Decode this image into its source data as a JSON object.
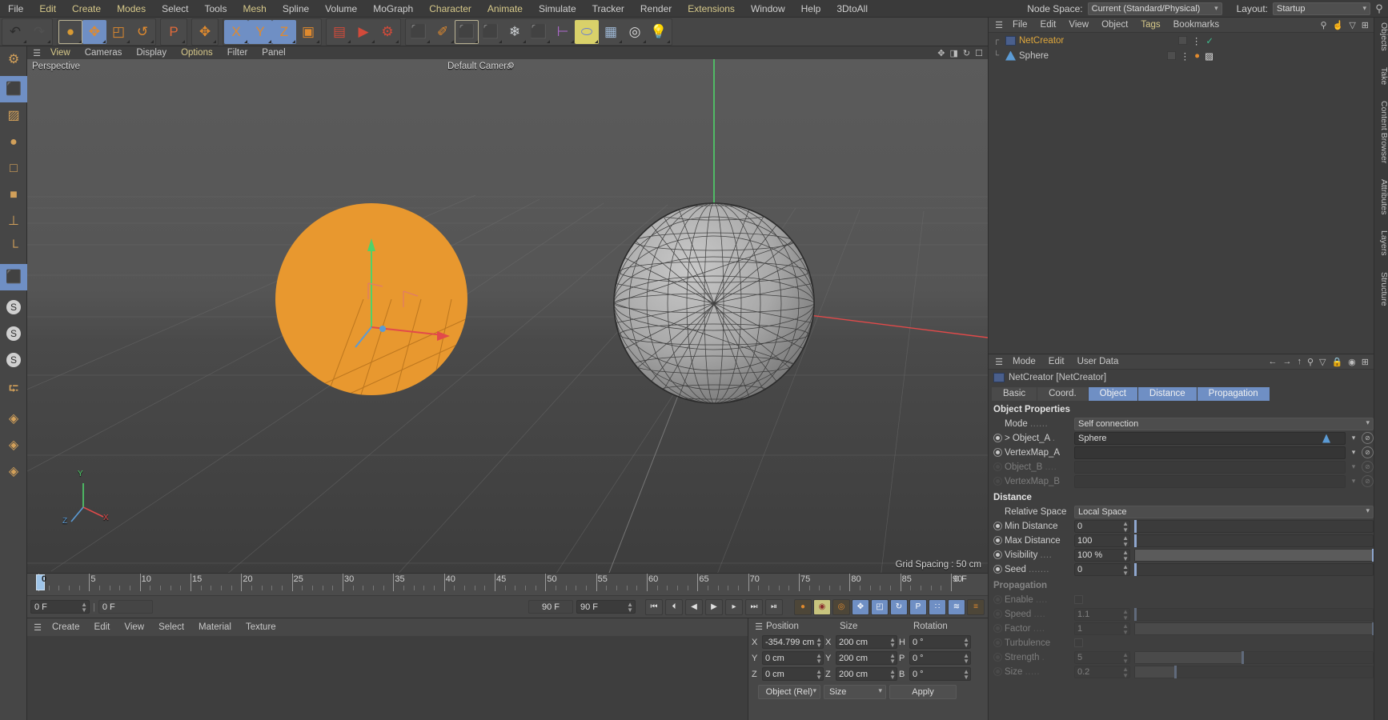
{
  "menubar": {
    "items": [
      {
        "label": "File",
        "hl": false
      },
      {
        "label": "Edit",
        "hl": true
      },
      {
        "label": "Create",
        "hl": true
      },
      {
        "label": "Modes",
        "hl": true
      },
      {
        "label": "Select",
        "hl": false
      },
      {
        "label": "Tools",
        "hl": false
      },
      {
        "label": "Mesh",
        "hl": true
      },
      {
        "label": "Spline",
        "hl": false
      },
      {
        "label": "Volume",
        "hl": false
      },
      {
        "label": "MoGraph",
        "hl": false
      },
      {
        "label": "Character",
        "hl": true
      },
      {
        "label": "Animate",
        "hl": true
      },
      {
        "label": "Simulate",
        "hl": false
      },
      {
        "label": "Tracker",
        "hl": false
      },
      {
        "label": "Render",
        "hl": false
      },
      {
        "label": "Extensions",
        "hl": true
      },
      {
        "label": "Window",
        "hl": false
      },
      {
        "label": "Help",
        "hl": false
      },
      {
        "label": "3DtoAll",
        "hl": false
      }
    ],
    "node_space_label": "Node Space:",
    "node_space_value": "Current (Standard/Physical)",
    "layout_label": "Layout:",
    "layout_value": "Startup",
    "search_icon": "search-icon"
  },
  "toolbar": {
    "groups": [
      {
        "buttons": [
          {
            "name": "undo-button",
            "glyph": "↶",
            "state": "normal",
            "color": "#2b2b2b"
          },
          {
            "name": "redo-button",
            "glyph": "↷",
            "state": "disabled",
            "color": "#5a5a5a"
          }
        ]
      },
      {
        "buttons": [
          {
            "name": "select-tool-button",
            "glyph": "●",
            "state": "framed",
            "color": "#d89a34"
          },
          {
            "name": "move-tool-button",
            "glyph": "✥",
            "state": "selected",
            "color": "#e08a2e"
          },
          {
            "name": "scale-tool-button",
            "glyph": "◰",
            "state": "normal",
            "color": "#e08a2e"
          },
          {
            "name": "rotate-tool-button",
            "glyph": "↺",
            "state": "normal",
            "color": "#e08a2e"
          }
        ]
      },
      {
        "buttons": [
          {
            "name": "prs-lock-button",
            "glyph": "P",
            "state": "normal",
            "color": "#e06a3a"
          }
        ]
      },
      {
        "buttons": [
          {
            "name": "world-object-axis-button",
            "glyph": "✥",
            "state": "normal",
            "color": "#e08a2e"
          }
        ]
      },
      {
        "buttons": [
          {
            "name": "x-axis-lock-button",
            "glyph": "X",
            "state": "selected",
            "color": "#e08a2e"
          },
          {
            "name": "y-axis-lock-button",
            "glyph": "Y",
            "state": "selected",
            "color": "#e08a2e"
          },
          {
            "name": "z-axis-lock-button",
            "glyph": "Z",
            "state": "selected",
            "color": "#e08a2e"
          },
          {
            "name": "world-coordinate-button",
            "glyph": "▣",
            "state": "normal",
            "color": "#e08a2e"
          }
        ]
      },
      {
        "buttons": [
          {
            "name": "render-view-button",
            "glyph": "▤",
            "state": "normal",
            "color": "#d24a3a"
          },
          {
            "name": "render-to-picture-viewer-button",
            "glyph": "▶",
            "state": "normal",
            "color": "#d24a3a"
          },
          {
            "name": "render-settings-button",
            "glyph": "⚙",
            "state": "normal",
            "color": "#d24a3a"
          }
        ]
      },
      {
        "buttons": [
          {
            "name": "cube-primitive-button",
            "glyph": "⬛",
            "state": "normal",
            "color": "#5b9bd5"
          },
          {
            "name": "spline-pen-button",
            "glyph": "✐",
            "state": "normal",
            "color": "#e08a2e"
          },
          {
            "name": "nurbs-generator-button",
            "glyph": "⬛",
            "state": "framed",
            "color": "#4caf50"
          },
          {
            "name": "array-button",
            "glyph": "⬛",
            "state": "normal",
            "color": "#4caf50"
          },
          {
            "name": "scene-nodes-button",
            "glyph": "❄",
            "state": "normal",
            "color": "#cfd3d6"
          },
          {
            "name": "cloner-button",
            "glyph": "⬛",
            "state": "normal",
            "color": "#4caf50"
          },
          {
            "name": "effector-button",
            "glyph": "⊢",
            "state": "normal",
            "color": "#b06ad0"
          },
          {
            "name": "field-button",
            "glyph": "⬭",
            "state": "selectedY",
            "color": "#6a7fd0"
          },
          {
            "name": "floor-button",
            "glyph": "▦",
            "state": "normal",
            "color": "#9db7d4"
          },
          {
            "name": "camera-button",
            "glyph": "◎",
            "state": "normal",
            "color": "#d8d8d8"
          },
          {
            "name": "light-button",
            "glyph": "💡",
            "state": "normal",
            "color": "#e6e6c0"
          }
        ]
      }
    ]
  },
  "leftbar": {
    "items": [
      {
        "name": "tool-make-editable-button",
        "glyph": "⚙",
        "selected": false
      },
      {
        "name": "model-mode-button",
        "glyph": "⬛",
        "selected": true
      },
      {
        "name": "texture-mode-button",
        "glyph": "▨",
        "selected": false
      },
      {
        "name": "points-mode-button",
        "glyph": "●",
        "selected": false
      },
      {
        "name": "edges-mode-button",
        "glyph": "□",
        "selected": false
      },
      {
        "name": "polygons-mode-button",
        "glyph": "■",
        "selected": false
      },
      {
        "name": "enable-axis-button",
        "glyph": "⊥",
        "selected": false
      },
      {
        "name": "axis-modify-button",
        "glyph": "└",
        "selected": false
      },
      {
        "name": "world-local-button",
        "glyph": "⬛",
        "selected": true
      },
      {
        "name": "snap-off-button",
        "glyph": "S",
        "selected": false
      },
      {
        "name": "snap-enable-button",
        "glyph": "S",
        "selected": false
      },
      {
        "name": "snap-settings-button",
        "glyph": "S",
        "selected": false
      },
      {
        "name": "magnet-tool-button",
        "glyph": "⮓",
        "selected": false
      },
      {
        "name": "workplane-button",
        "glyph": "◈",
        "selected": false
      },
      {
        "name": "lock-workplane-button",
        "glyph": "◈",
        "selected": false
      },
      {
        "name": "planar-workplane-button",
        "glyph": "◈",
        "selected": false
      }
    ]
  },
  "viewport": {
    "menu": [
      {
        "label": "View",
        "hl": true
      },
      {
        "label": "Cameras",
        "hl": false
      },
      {
        "label": "Display",
        "hl": false
      },
      {
        "label": "Options",
        "hl": true
      },
      {
        "label": "Filter",
        "hl": false
      },
      {
        "label": "Panel",
        "hl": false
      }
    ],
    "perspective_label": "Perspective",
    "camera_label": "Default Camera",
    "grid_spacing": "Grid Spacing : 50 cm",
    "axis_legend": {
      "y": "Y",
      "z": "Z",
      "x": "X"
    },
    "header_icons": [
      "viewport-move-icon",
      "viewport-scale-icon",
      "viewport-rotate-icon",
      "viewport-maximize-icon"
    ]
  },
  "timeline": {
    "ticks": [
      0,
      5,
      10,
      15,
      20,
      25,
      30,
      35,
      40,
      45,
      50,
      55,
      60,
      65,
      70,
      75,
      80,
      85,
      90
    ],
    "current_frame_marker": "0",
    "start_field": "0 F",
    "current_field": "0 F",
    "end_field": "90 F",
    "preview_end_field": "90 F",
    "right_frame_field": "0 F",
    "transport": [
      {
        "name": "go-to-start-button",
        "glyph": "⏮"
      },
      {
        "name": "previous-key-button",
        "glyph": "⏴"
      },
      {
        "name": "previous-frame-button",
        "glyph": "◀"
      },
      {
        "name": "play-button",
        "glyph": "▶"
      },
      {
        "name": "next-frame-button",
        "glyph": "▸"
      },
      {
        "name": "next-key-button",
        "glyph": "⏭"
      },
      {
        "name": "go-to-end-button",
        "glyph": "⏯"
      }
    ],
    "record_buttons": [
      {
        "name": "record-active-objects-button",
        "glyph": "●",
        "style": "orange"
      },
      {
        "name": "autokeying-button",
        "glyph": "◉",
        "style": "yellow"
      },
      {
        "name": "keyframe-selection-button",
        "glyph": "◎",
        "style": "orange"
      },
      {
        "name": "position-key-button",
        "glyph": "✥",
        "style": "blue"
      },
      {
        "name": "scale-key-button",
        "glyph": "◰",
        "style": "blue"
      },
      {
        "name": "rotation-key-button",
        "glyph": "↻",
        "style": "blue"
      },
      {
        "name": "parameter-key-button",
        "glyph": "P",
        "style": "blue"
      },
      {
        "name": "pla-key-button",
        "glyph": "∷",
        "style": "blue"
      },
      {
        "name": "simulation-playback-button",
        "glyph": "≋",
        "style": "blue"
      },
      {
        "name": "timeline-toggle-button",
        "glyph": "≡",
        "style": "orange"
      }
    ]
  },
  "material_manager": {
    "menu": [
      "Create",
      "Edit",
      "View",
      "Select",
      "Material",
      "Texture"
    ]
  },
  "coordinates": {
    "headers": [
      "Position",
      "Size",
      "Rotation"
    ],
    "rows": [
      {
        "axis1": "X",
        "val1": "-354.799 cm",
        "axis2": "X",
        "val2": "200 cm",
        "axis3": "H",
        "val3": "0 °"
      },
      {
        "axis1": "Y",
        "val1": "0 cm",
        "axis2": "Y",
        "val2": "200 cm",
        "axis3": "P",
        "val3": "0 °"
      },
      {
        "axis1": "Z",
        "val1": "0 cm",
        "axis2": "Z",
        "val2": "200 cm",
        "axis3": "B",
        "val3": "0 °"
      }
    ],
    "mode_select": "Object (Rel)",
    "size_select": "Size",
    "apply_button": "Apply"
  },
  "object_manager": {
    "menu": [
      {
        "label": "File",
        "hl": false
      },
      {
        "label": "Edit",
        "hl": false
      },
      {
        "label": "View",
        "hl": false
      },
      {
        "label": "Object",
        "hl": false
      },
      {
        "label": "Tags",
        "hl": true
      },
      {
        "label": "Bookmarks",
        "hl": false
      }
    ],
    "icons": [
      "search-icon",
      "home-icon",
      "filter-icon",
      "new-view-icon"
    ],
    "objects": [
      {
        "name": "NetCreator",
        "selected": true,
        "icon": "netcreator-icon",
        "tags": [
          "check-tag"
        ]
      },
      {
        "name": "Sphere",
        "selected": false,
        "icon": "sphere-icon",
        "tags": [
          "vertexmap-tag",
          "checker-tag"
        ]
      }
    ]
  },
  "attribute_manager": {
    "menu": [
      "Mode",
      "Edit",
      "User Data"
    ],
    "icons": [
      "back-arrow-icon",
      "forward-arrow-icon",
      "up-arrow-icon",
      "search-icon",
      "filter-icon",
      "lock-icon",
      "record-icon",
      "new-icon"
    ],
    "object_title": "NetCreator [NetCreator]",
    "tabs": [
      {
        "label": "Basic",
        "active": false
      },
      {
        "label": "Coord.",
        "active": false
      },
      {
        "label": "Object",
        "active": true
      },
      {
        "label": "Distance",
        "active": true
      },
      {
        "label": "Propagation",
        "active": true
      }
    ],
    "sections": [
      {
        "title": "Object Properties",
        "dim": false,
        "rows": [
          {
            "name": "mode-row",
            "radio": "none",
            "label": "Mode",
            "dots": "......",
            "type": "select",
            "value": "Self connection"
          },
          {
            "name": "object-a-row",
            "radio": "on",
            "label": "> Object_A",
            "dots": ".",
            "type": "link",
            "value": "Sphere",
            "link_icon": "sphere-icon"
          },
          {
            "name": "vertexmap-a-row",
            "radio": "on",
            "label": "VertexMap_A",
            "dots": "",
            "type": "link",
            "value": ""
          },
          {
            "name": "object-b-row",
            "radio": "off",
            "label": "Object_B",
            "dots": "....",
            "type": "link",
            "value": "",
            "dim": true
          },
          {
            "name": "vertexmap-b-row",
            "radio": "off",
            "label": "VertexMap_B",
            "dots": "",
            "type": "link",
            "value": "",
            "dim": true
          }
        ]
      },
      {
        "title": "Distance",
        "dim": false,
        "rows": [
          {
            "name": "relative-space-row",
            "radio": "none",
            "label": "Relative Space",
            "dots": "",
            "type": "select",
            "value": "Local Space"
          },
          {
            "name": "min-distance-row",
            "radio": "on",
            "label": "Min Distance",
            "dots": "",
            "type": "numslider",
            "value": "0",
            "fill_pct": 0
          },
          {
            "name": "max-distance-row",
            "radio": "on",
            "label": "Max Distance",
            "dots": "",
            "type": "numslider",
            "value": "100",
            "fill_pct": 0
          },
          {
            "name": "visibility-row",
            "radio": "on",
            "label": "Visibility",
            "dots": "....",
            "type": "numslider",
            "value": "100 %",
            "fill_pct": 100
          },
          {
            "name": "seed-row",
            "radio": "on",
            "label": "Seed",
            "dots": ".......",
            "type": "numslider",
            "value": "0",
            "fill_pct": 0
          }
        ]
      },
      {
        "title": "Propagation",
        "dim": true,
        "rows": [
          {
            "name": "enable-row",
            "radio": "off",
            "label": "Enable",
            "dots": "....",
            "type": "checkbox",
            "value": ""
          },
          {
            "name": "speed-row",
            "radio": "off",
            "label": "Speed",
            "dots": "....",
            "type": "numslider",
            "value": "1.1",
            "fill_pct": 0
          },
          {
            "name": "factor-row",
            "radio": "off",
            "label": "Factor",
            "dots": "....",
            "type": "numslider",
            "value": "1",
            "fill_pct": 100
          },
          {
            "name": "turbulence-row",
            "radio": "off",
            "label": "Turbulence",
            "dots": "",
            "type": "checkbox",
            "value": ""
          },
          {
            "name": "strength-row",
            "radio": "off",
            "label": "Strength",
            "dots": ".",
            "type": "numslider",
            "value": "5",
            "fill_pct": 45
          },
          {
            "name": "size-row",
            "radio": "off",
            "label": "Size",
            "dots": ".....",
            "type": "numslider",
            "value": "0.2",
            "fill_pct": 17
          }
        ]
      }
    ]
  },
  "far_right_tabs": [
    "Objects",
    "Take",
    "Content Browser",
    "Attributes",
    "Layers",
    "Structure"
  ],
  "colors": {
    "accent_blue": "#6f8fc4",
    "accent_orange": "#e08a2e",
    "sphere_orange": "#e8982f",
    "panel_bg": "#3f3f3f",
    "toolbar_bg": "#464646"
  }
}
